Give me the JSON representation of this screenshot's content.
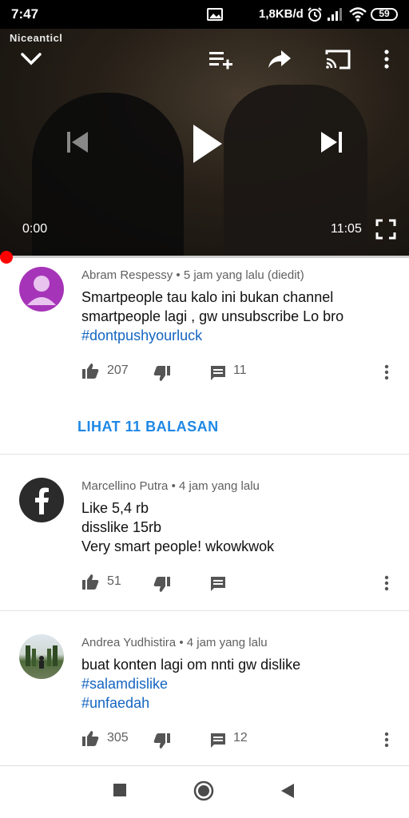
{
  "status_bar": {
    "time": "7:47",
    "network_speed": "1,8KB/d",
    "battery": "59"
  },
  "player": {
    "watermark": "Niceanticl",
    "current_time": "0:00",
    "duration": "11:05",
    "progress": 0
  },
  "comments": [
    {
      "author": "Abram Respessy",
      "time": "5 jam yang lalu (diedit)",
      "lines": [
        "Smartpeople tau kalo ini bukan channel",
        "smartpeople lagi , gw unsubscribe Lo bro"
      ],
      "hashtags": [
        "#dontpushyourluck"
      ],
      "likes": "207",
      "replies_count": "11",
      "view_replies_label": "LIHAT 11 BALASAN"
    },
    {
      "author": "Marcellino Putra",
      "time": "4 jam yang lalu",
      "lines": [
        "Like 5,4 rb",
        "disslike 15rb",
        "Very smart people! wkowkwok"
      ],
      "hashtags": [],
      "likes": "51",
      "replies_count": ""
    },
    {
      "author": "Andrea Yudhistira",
      "time": "4 jam yang lalu",
      "lines": [
        "buat konten lagi om nnti gw dislike"
      ],
      "hashtags": [
        "#salamdislike",
        "#unfaedah"
      ],
      "likes": "305",
      "replies_count": "12"
    }
  ],
  "colors": {
    "accent": "#1e88e5",
    "hashtag": "#1565c0",
    "progress": "#ff0000",
    "meta": "#606060"
  }
}
